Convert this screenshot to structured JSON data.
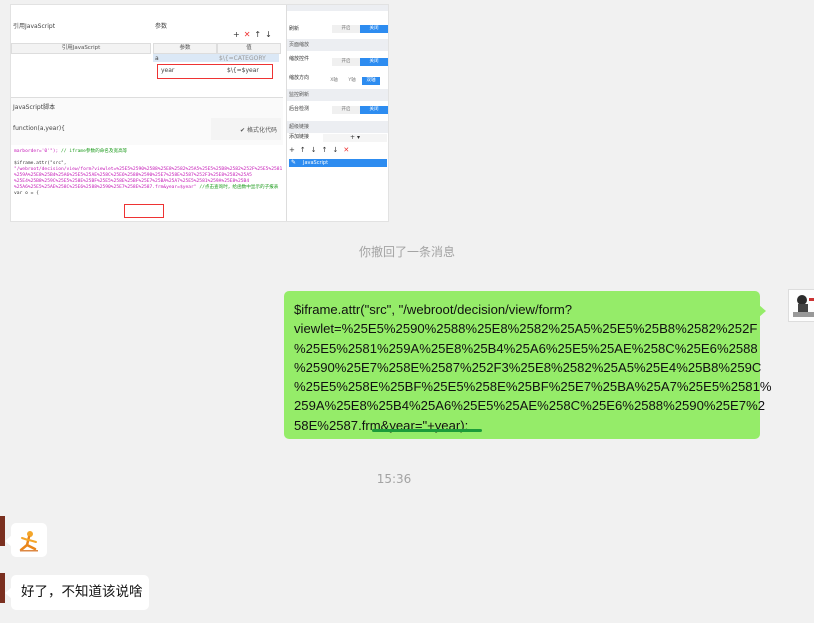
{
  "screenshot": {
    "left_panel": {
      "title": "引用JavaScript",
      "column_header": "引用JavaScript"
    },
    "param_panel": {
      "title": "参数",
      "col_name": "参数",
      "col_value": "值",
      "rows": [
        {
          "name": "a",
          "value": "$\\{=CATEGORY"
        },
        {
          "name": "year",
          "value": "$\\{=$year"
        }
      ]
    },
    "js_section": {
      "title": "JavaScript脚本",
      "signature": "function(a,year){",
      "format_button": "格式化代码"
    },
    "code_lines": [
      {
        "text": "marborder='0'\");",
        "comment": " // iframe参数的命名及宽高等"
      },
      {
        "text": "",
        "comment": ""
      },
      {
        "text": "$iframe.attr(\"src\",",
        "comment": ""
      },
      {
        "text": "\"/webroot/decision/view/form?viewlet=%25E5%2590%2588%25E8%2582%25A5%25E5%25B8%2582%252F%25E5%2581",
        "comment": ""
      },
      {
        "text": "%259A%25E8%25B4%25A6%25E5%25AE%258C%25E6%2588%2590%25E7%258E%2587%252F3%25E8%2582%25A5",
        "comment": ""
      },
      {
        "text": "%25E4%25B8%259C%25E5%258E%25BF%25E5%258E%25BF%25E7%25BA%25A7%25E5%2581%259A%25E8%25B4",
        "comment": ""
      },
      {
        "text": "%25A6%25E5%25AE%258C%25E6%2588%2590%25E7%258E%2587.frm&year=$year\"",
        "comment": " //点击查询时，给函数中显示的子报表"
      },
      {
        "text": "var o = {",
        "comment": ""
      }
    ],
    "right_panel": {
      "rows": [
        {
          "label": "刷新",
          "off": "开启",
          "on": "关闭"
        },
        {
          "label": "页面缩放",
          "off": "",
          "on": ""
        },
        {
          "label": "缩放控件",
          "off": "开启",
          "on": "关闭"
        },
        {
          "label": "缩放方向",
          "opt1": "X轴",
          "opt2": "Y轴",
          "opt3": "双轴"
        },
        {
          "label": "监控刷新",
          "off": "",
          "on": ""
        },
        {
          "label": "后台检测",
          "off": "开启",
          "on": "关闭"
        },
        {
          "label": "超级链接",
          "off": "",
          "on": ""
        },
        {
          "label": "添加链接",
          "off": "",
          "on": ""
        }
      ],
      "add_button": "+ ▾",
      "list_item": "JavaScript"
    }
  },
  "chat": {
    "recalled_notice": "你撤回了一条消息",
    "message_right_lines": [
      "$iframe.attr(\"src\", \"/webroot/decision/view/form?",
      "viewlet=%25E5%2590%2588%25E8%2582%25A5%25E5%25B8%2582%252F",
      "%25E5%2581%259A%25E8%25B4%25A6%25E5%25AE%258C%25E6%2588",
      "%2590%25E7%258E%2587%252F3%25E8%2582%25A5%25E4%25B8%259C",
      "%25E5%258E%25BF%25E5%258E%25BF%25E7%25BA%25A7%25E5%2581%",
      "259A%25E8%25B4%25A6%25E5%25AE%258C%25E6%2588%2590%25E7%2",
      "58E%2587.frm&year=\"+year);"
    ],
    "timestamp": "15:36",
    "sticker_name": "dance-sticker",
    "message_left_text": "好了，不知道该说啥"
  },
  "colors": {
    "bubble_self": "#95ec69",
    "bubble_other": "#ffffff",
    "background": "#f1f1f1",
    "underline": "#1c9c3a"
  }
}
